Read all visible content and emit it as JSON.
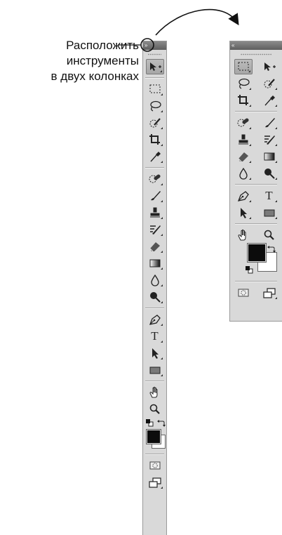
{
  "annotation": {
    "lines": [
      "Расположить",
      "инструменты",
      "в двух колонках"
    ]
  },
  "panel": {
    "collapse_glyph": "»",
    "expand_glyph": "«",
    "tool_icons_single_column": [
      "move-icon",
      "rectangular-marquee-icon",
      "lasso-icon",
      "quick-selection-icon",
      "crop-icon",
      "eyedropper-icon",
      "spot-healing-brush-icon",
      "brush-icon",
      "clone-stamp-icon",
      "history-brush-icon",
      "eraser-icon",
      "gradient-icon",
      "blur-icon",
      "dodge-icon",
      "pen-icon",
      "type-icon",
      "path-selection-icon",
      "rectangle-shape-icon",
      "hand-icon",
      "zoom-icon",
      "default-colors-icon",
      "swap-colors-icon",
      "foreground-color",
      "background-color",
      "quick-mask-icon",
      "screen-mode-icon"
    ],
    "type_tool_label": "T",
    "colors": {
      "panel_bg": "#d9d9d9",
      "header": "#6e6e6e",
      "foreground": "#0c0c0c",
      "background": "#ffffff",
      "active_tool": "#b0b0b0"
    }
  }
}
